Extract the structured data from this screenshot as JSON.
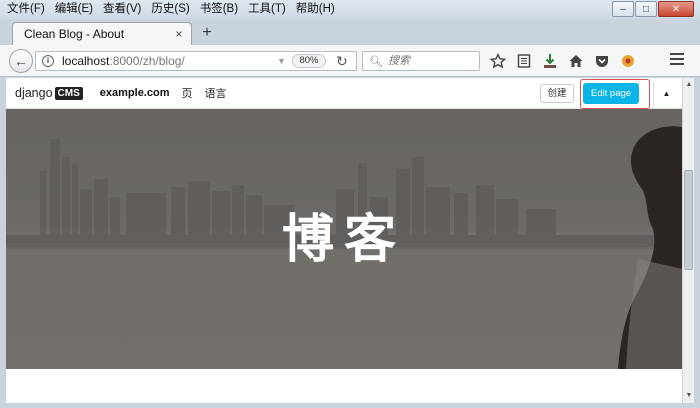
{
  "menubar": {
    "items": [
      "文件(F)",
      "编辑(E)",
      "查看(V)",
      "历史(S)",
      "书签(B)",
      "工具(T)",
      "帮助(H)"
    ],
    "window_controls": {
      "minimize": "–",
      "maximize": "□",
      "close": "✕"
    }
  },
  "tab": {
    "title": "Clean Blog - About",
    "close": "×",
    "new_tab": "+"
  },
  "navbar": {
    "url_host": "localhost",
    "url_path": ":8000/zh/blog/",
    "zoom": "80%",
    "search_placeholder": "搜索"
  },
  "cms": {
    "logo_text": "django",
    "logo_badge": "CMS",
    "site": "example.com",
    "nav": [
      "页",
      "语言"
    ],
    "create_label": "创建",
    "edit_label": "Edit page",
    "collapse": "▲"
  },
  "hero": {
    "title": "博客"
  },
  "icons": [
    "info-icon",
    "search-icon",
    "star-icon",
    "reading-list-icon",
    "download-icon",
    "home-icon",
    "pocket-icon",
    "extension-icon",
    "menu-icon"
  ],
  "colors": {
    "edit_button": "#0bb4e6",
    "highlight": "#d6534f",
    "chrome": "#c9d3de"
  }
}
